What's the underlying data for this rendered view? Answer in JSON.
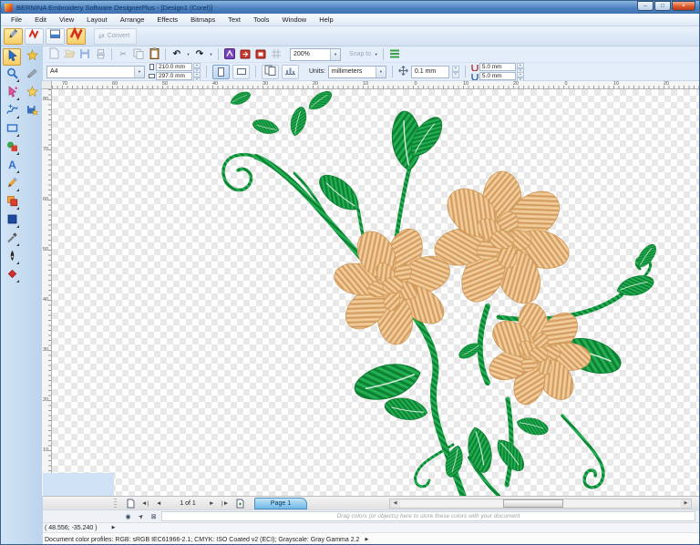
{
  "window": {
    "title": "BERNINA Embroidery Software DesignerPlus - [Design1 (Corel)]",
    "controls": [
      "minimize",
      "restore",
      "close"
    ]
  },
  "menubar": {
    "items": [
      "File",
      "Edit",
      "View",
      "Layout",
      "Arrange",
      "Effects",
      "Bitmaps",
      "Text",
      "Tools",
      "Window",
      "Help"
    ]
  },
  "mode_toolbar": {
    "modes": [
      "artwork-canvas",
      "embroidery-canvas-small",
      "embroidery-library",
      "embroidery-canvas"
    ],
    "selected_modes": [
      "artwork-canvas",
      "embroidery-canvas"
    ],
    "convert_label": "Convert"
  },
  "standard_toolbar": {
    "icons": [
      "new-dim",
      "open-dim",
      "save-dim",
      "print-dim",
      "cut",
      "copy",
      "paste",
      "undo",
      "redo",
      "insert-embroidery",
      "open-object",
      "save-object",
      "grid-dim",
      "zoom-combo",
      "snap-combo",
      "object-properties"
    ],
    "zoom_value": "200%",
    "snap_label": "Snap to"
  },
  "property_bar": {
    "paper_size_value": "A4",
    "page_width_value": "210.0 mm",
    "page_height_value": "297.0 mm",
    "units_label": "Units:",
    "units_value": "millimeters",
    "nudge_value": "0.1 mm",
    "grid_spacing_x_value": "5.0 mm",
    "grid_spacing_y_value": "5.0 mm"
  },
  "toolbox": {
    "tools": [
      "select-tool",
      "zoom-tool",
      "reshape-tool",
      "freehand-draw-tool",
      "rectangle-tool",
      "shapes-tool",
      "lettering-tool",
      "pencil-tool",
      "duplicate-tool",
      "fill-tool",
      "eyedropper-tool",
      "pen-tool",
      "carving-stamp-tool"
    ],
    "secondary_tools": [
      "design-star-tool",
      "knife-tool",
      "star-shape-tool",
      "save-design-tool"
    ],
    "selected_tool": "select-tool"
  },
  "rulers": {
    "horizontal_labels": [
      "70",
      "60",
      "50",
      "40",
      "30",
      "20",
      "10",
      "0",
      "10",
      "20",
      "0",
      "10",
      "20"
    ],
    "vertical_labels": [
      "80",
      "70",
      "60",
      "50",
      "40",
      "30",
      "20",
      "10"
    ]
  },
  "page_bar": {
    "page_indicator": "1 of 1",
    "page_tab_label": "Page 1"
  },
  "color_palette": {
    "hint_text": "Drag colors (or objects) here to store these colors with your document"
  },
  "status_bar": {
    "cursor_position": "( 48.556; -35.240 )",
    "color_profiles": "Document color profiles: RGB: sRGB IEC61966-2.1; CMYK: ISO Coated v2 (ECI); Grayscale: Gray Gamma 2.2"
  },
  "design": {
    "flower_thread_color": "#eabc82",
    "flower_stitch_color": "#d0985c",
    "leaf_thread_color": "#17a046",
    "leaf_stitch_color": "#0b7c30"
  }
}
